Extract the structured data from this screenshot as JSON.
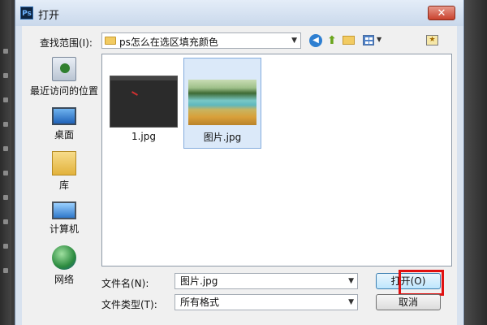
{
  "window": {
    "title": "打开",
    "app_icon": "Ps",
    "close_glyph": "✕"
  },
  "toolbar": {
    "lookin_label": "查找范围(I):",
    "lookin_value": "ps怎么在选区填充颜色",
    "icons": [
      "back-icon",
      "up-folder-icon",
      "new-folder-icon",
      "view-menu-icon",
      "recent-places-icon"
    ]
  },
  "places": [
    {
      "label": "最近访问的位置",
      "icon": "recent-places-icon"
    },
    {
      "label": "桌面",
      "icon": "desktop-icon"
    },
    {
      "label": "库",
      "icon": "library-icon"
    },
    {
      "label": "计算机",
      "icon": "computer-icon"
    },
    {
      "label": "网络",
      "icon": "network-icon"
    }
  ],
  "files": [
    {
      "name": "1.jpg",
      "selected": false
    },
    {
      "name": "图片.jpg",
      "selected": true
    }
  ],
  "bottom": {
    "filename_label": "文件名(N):",
    "filename_value": "图片.jpg",
    "filetype_label": "文件类型(T):",
    "filetype_value": "所有格式",
    "open_button": "打开(O)",
    "cancel_button": "取消"
  },
  "colors": {
    "highlight": "#e01010",
    "selection": "#dbe9f9",
    "title_bar": "#c9d8eb"
  }
}
